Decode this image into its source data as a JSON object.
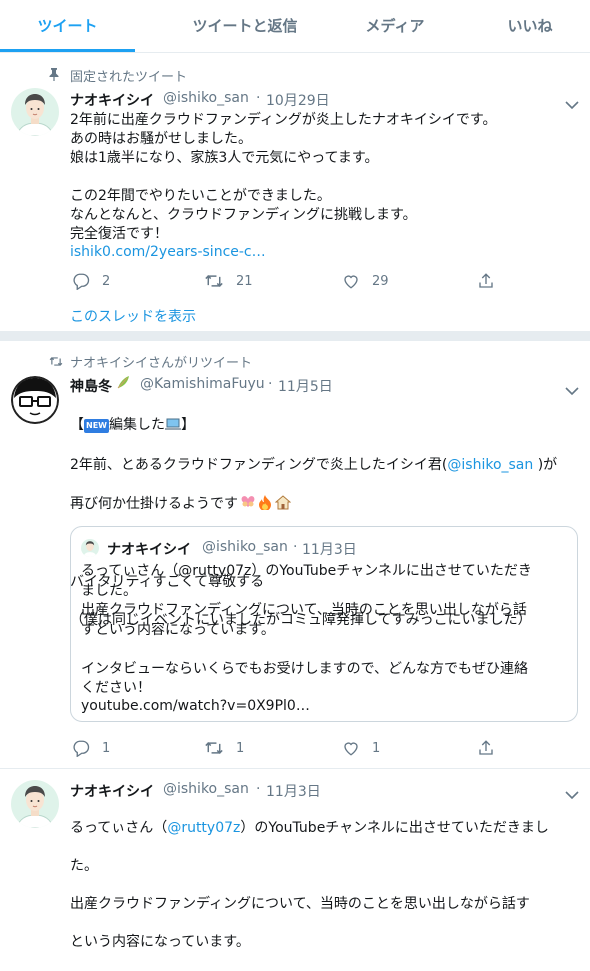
{
  "tabs": [
    "ツイート",
    "ツイートと返信",
    "メディア",
    "いいね"
  ],
  "tweet1": {
    "context": "固定されたツイート",
    "name": "ナオキイシイ",
    "handle": "@ishiko_san",
    "date": "10月29日",
    "text": "2年前に出産クラウドファンディングが炎上したナオキイシイです。\nあの時はお騒がせしました。\n娘は1歳半になり、家族3人で元気にやってます。\n\nこの2年間でやりたいことができました。\nなんとなんと、クラウドファンディングに挑戦します。\n完全復活です！",
    "link": "ishik0.com/2years-since-c…",
    "replies": "2",
    "retweets": "21",
    "likes": "29",
    "thread": "このスレッドを表示"
  },
  "tweet2": {
    "context": "ナオキイシイさんがリツイート",
    "name": "神島冬",
    "handle": "@KamishimaFuyu",
    "date": "11月5日",
    "line1_a": "【",
    "line1_badge": "NEW",
    "line1_b": "編集した",
    "line1_c": "】",
    "line2_a": "2年前、とあるクラウドファンディングで炎上したイシイ君(",
    "line2_mention": "@ishiko_san",
    "line2_b": " )が",
    "line3": "再び何か仕掛けるようです",
    "line4": "バイタリティすごくて尊敬する",
    "line5": "（僕は同じイベントにいましたがコミュ障発揮してすみっこにいました）",
    "replies": "1",
    "retweets": "1",
    "likes": "1"
  },
  "quote": {
    "name": "ナオキイシイ",
    "handle": "@ishiko_san",
    "date": "11月3日",
    "text": "るってぃさん（@rutty07z）のYouTubeチャンネルに出させていただき\nました。\n出産クラウドファンディングについて、当時のことを思い出しながら話\nすという内容になっています。\n\nインタビューならいくらでもお受けしますので、どんな方でもぜひ連絡\nください！",
    "link": "youtube.com/watch?v=0X9Pl0…"
  },
  "tweet3": {
    "name": "ナオキイシイ",
    "handle": "@ishiko_san",
    "date": "11月3日",
    "line1_a": "るってぃさん（",
    "line1_mention": "@rutty07z",
    "line1_b": "）のYouTubeチャンネルに出させていただきまし",
    "line2": "た。",
    "line3": "出産クラウドファンディングについて、当時のことを思い出しながら話す",
    "line4": "という内容になっています。"
  },
  "separator": "·",
  "colors": {
    "accent": "#1da1f2",
    "link": "#1b95e0",
    "muted": "#657786",
    "border": "#e6ecf0"
  }
}
